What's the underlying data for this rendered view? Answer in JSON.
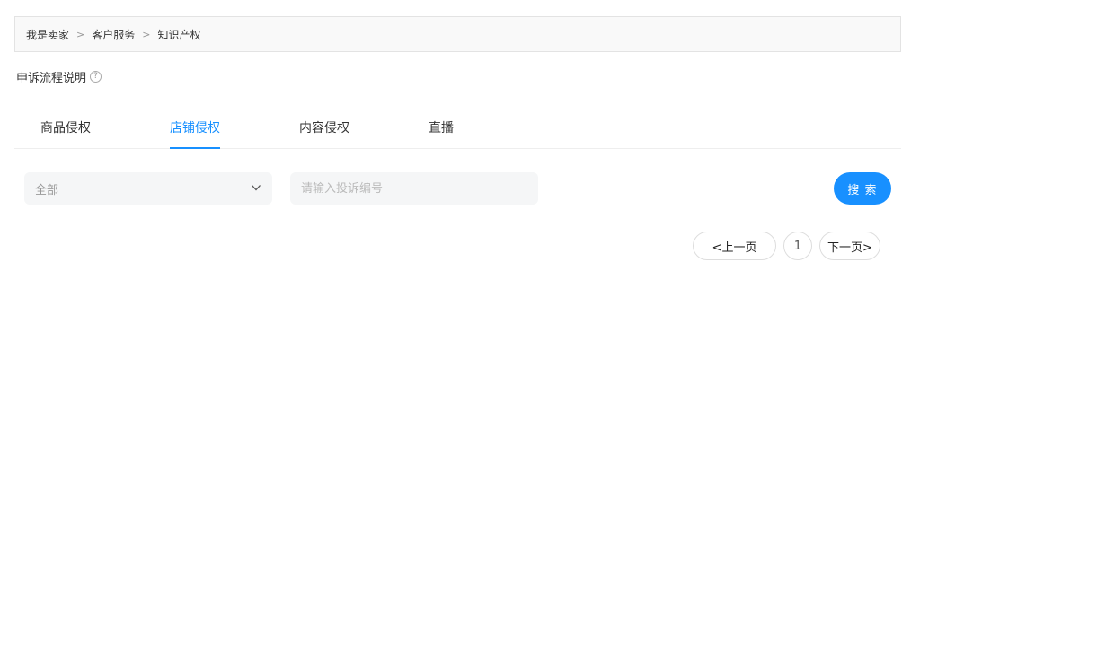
{
  "breadcrumb": {
    "items": [
      "我是卖家",
      "客户服务",
      "知识产权"
    ],
    "separator": ">"
  },
  "process": {
    "label": "申诉流程说明",
    "help_icon": "?"
  },
  "tabs": [
    {
      "label": "商品侵权",
      "active": false
    },
    {
      "label": "店铺侵权",
      "active": true
    },
    {
      "label": "内容侵权",
      "active": false
    },
    {
      "label": "直播",
      "active": false
    }
  ],
  "filters": {
    "select_value": "全部",
    "complaint_input_placeholder": "请输入投诉编号",
    "complaint_input_value": "",
    "search_label": "搜 索"
  },
  "pagination": {
    "prev_label": "<上一页",
    "current_page": "1",
    "next_label": "下一页>"
  },
  "colors": {
    "accent": "#1890ff",
    "field_bg": "#f5f6f7",
    "breadcrumb_bg": "#f9f9f9"
  }
}
